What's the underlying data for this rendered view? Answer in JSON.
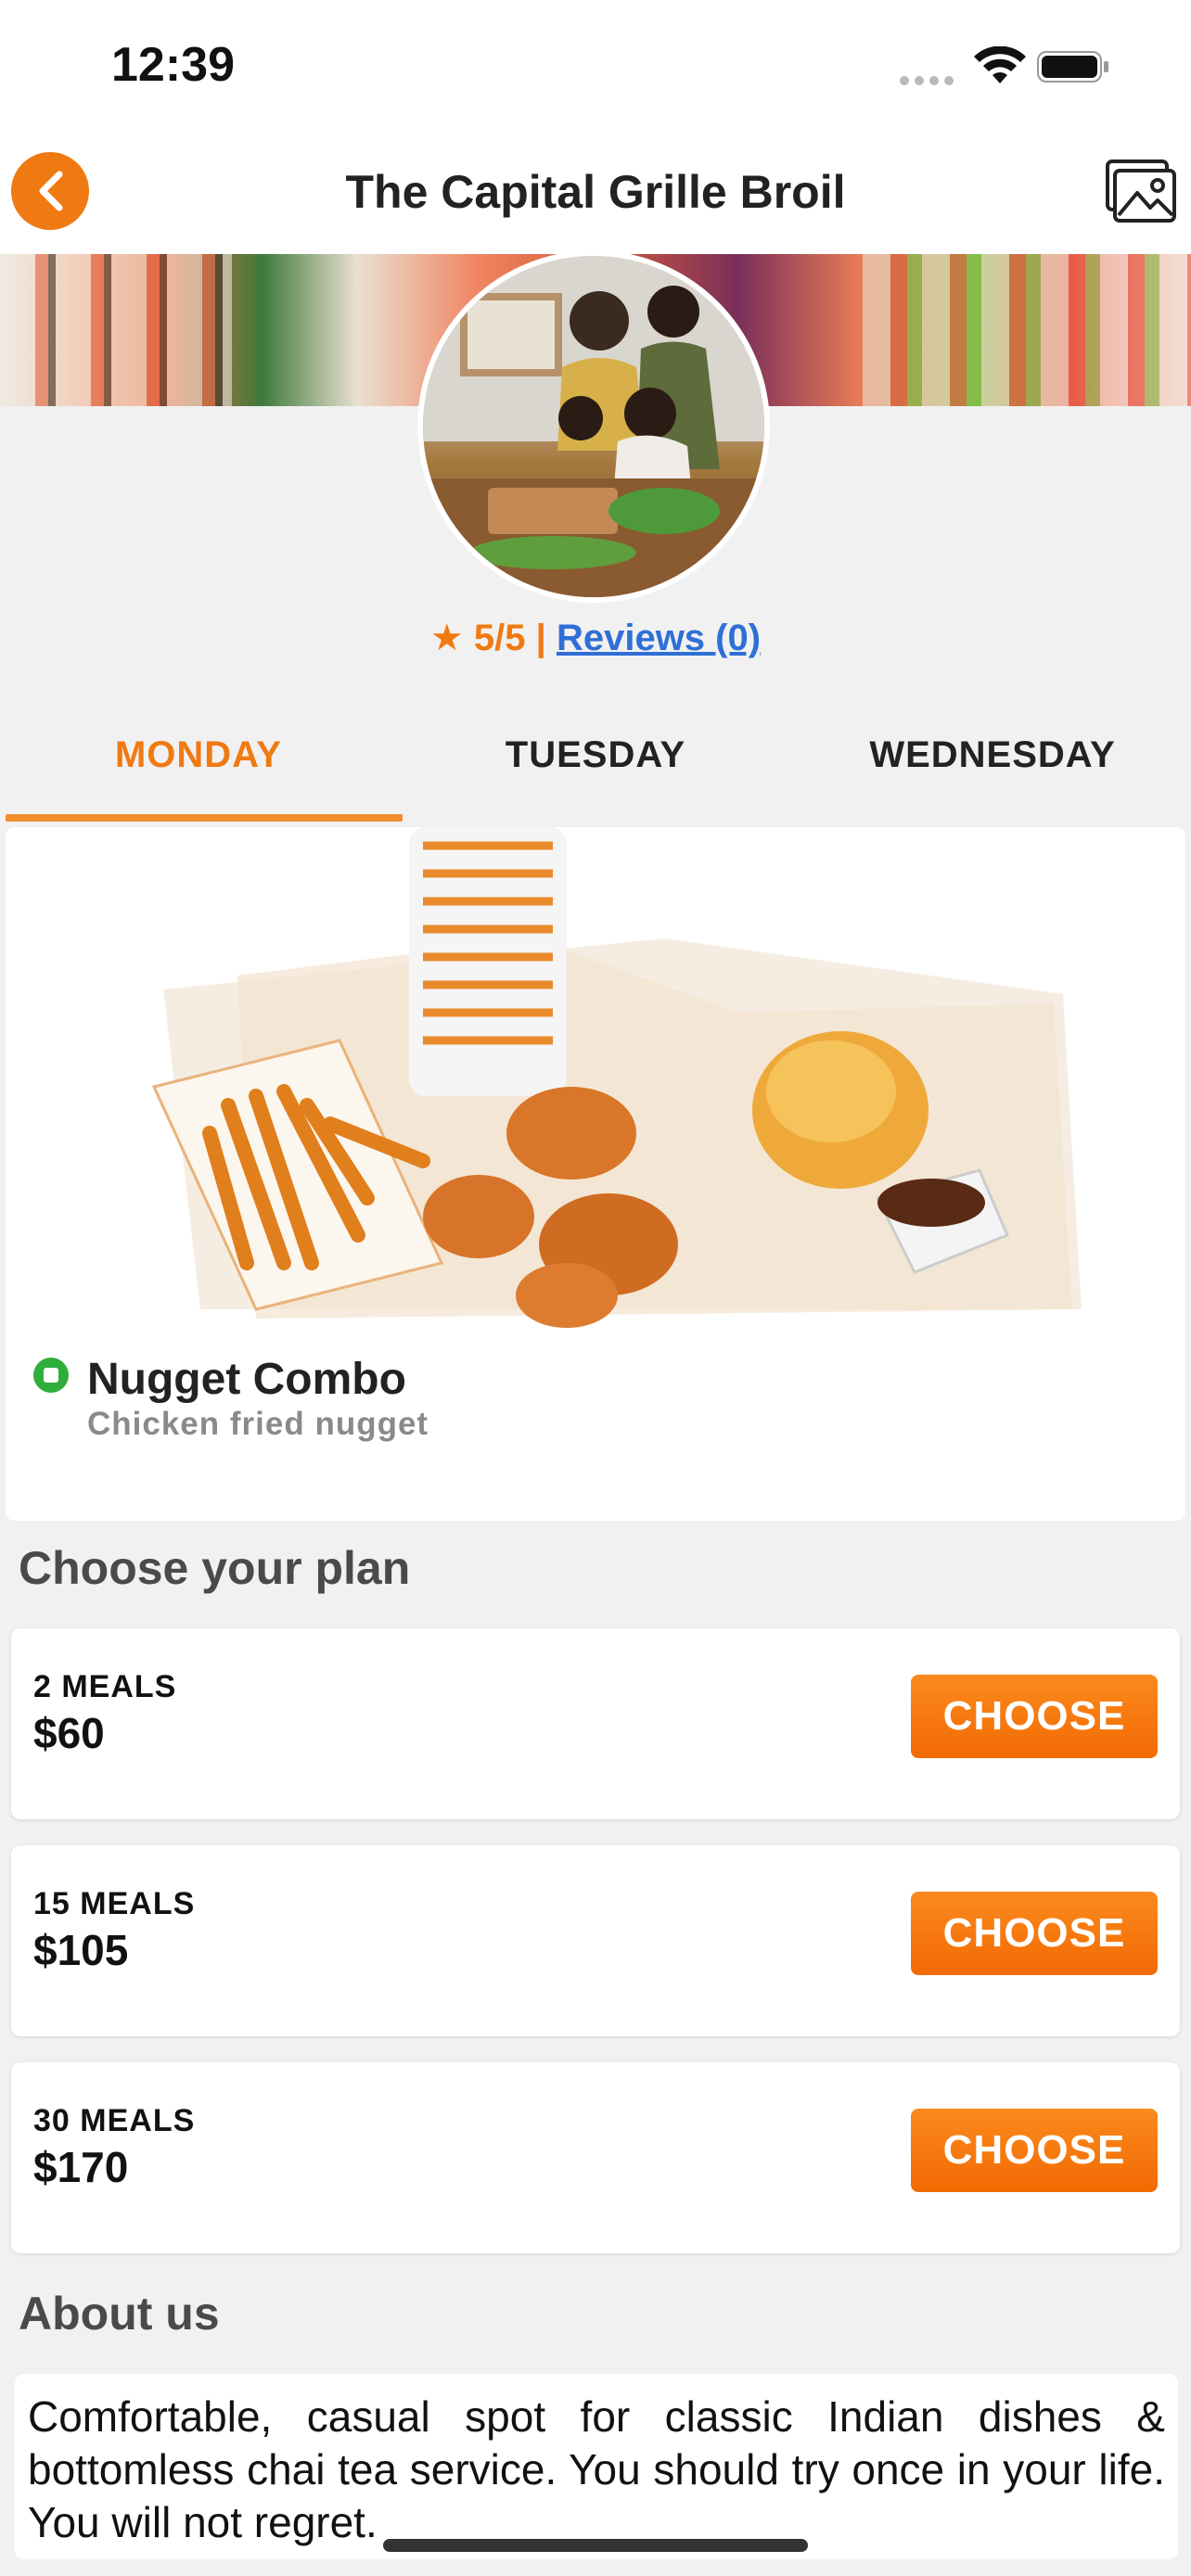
{
  "status_bar": {
    "time": "12:39"
  },
  "nav": {
    "title": "The Capital Grille Broil"
  },
  "rating": {
    "star": "★",
    "score": "5/5 |",
    "reviews": " Reviews (0)"
  },
  "tabs": [
    {
      "label": "MONDAY",
      "active": true
    },
    {
      "label": "TUESDAY",
      "active": false
    },
    {
      "label": "WEDNESDAY",
      "active": false
    }
  ],
  "meal": {
    "name": "Nugget Combo",
    "description": "Chicken fried nugget"
  },
  "plans": {
    "title": "Choose your plan",
    "items": [
      {
        "meals": "2 MEALS",
        "price": "$60",
        "button": "CHOOSE"
      },
      {
        "meals": "15 MEALS",
        "price": "$105",
        "button": "CHOOSE"
      },
      {
        "meals": "30 MEALS",
        "price": "$170",
        "button": "CHOOSE"
      }
    ]
  },
  "about": {
    "title": "About us",
    "text": "Comfortable, casual spot for classic Indian dishes & bottomless chai tea service. You should try once in your life. You will not regret."
  },
  "colors": {
    "accent": "#f07a12",
    "link": "#2f6fd6",
    "veg": "#2fae3c"
  }
}
